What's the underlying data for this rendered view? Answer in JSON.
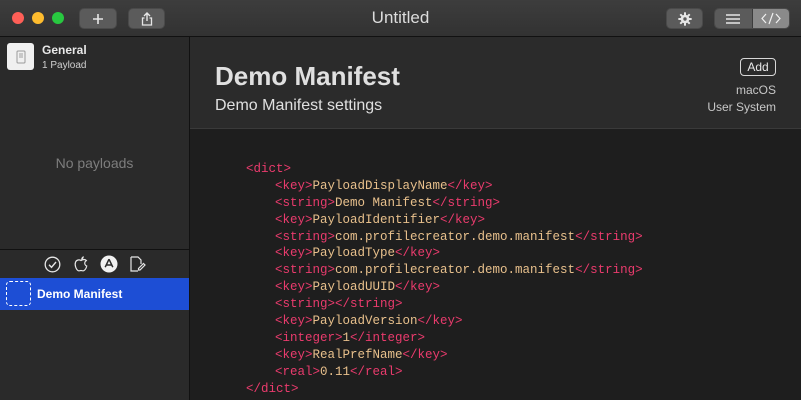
{
  "window": {
    "title": "Untitled",
    "toolbar": {
      "add_icon": "plus-icon",
      "share_icon": "share-icon",
      "gear_icon": "gear-icon",
      "view_list_icon": "list-icon",
      "view_code_icon": "code-icon"
    }
  },
  "sidebar": {
    "general": {
      "name": "General",
      "subtitle": "1 Payload",
      "icon": "document-icon"
    },
    "empty_text": "No payloads",
    "filters": [
      {
        "icon": "checkmark-circle-icon"
      },
      {
        "icon": "apple-icon"
      },
      {
        "icon": "app-store-icon"
      },
      {
        "icon": "edit-document-icon"
      }
    ],
    "manifests": [
      {
        "label": "Demo Manifest",
        "selected": true
      }
    ]
  },
  "header": {
    "title": "Demo Manifest",
    "subtitle": "Demo Manifest settings",
    "add_label": "Add",
    "platform": "macOS",
    "scope": "User System"
  },
  "code": {
    "open_dict": "<dict>",
    "close_dict": "</dict>",
    "entries": [
      {
        "tag": "key",
        "value": "PayloadDisplayName"
      },
      {
        "tag": "string",
        "value": "Demo Manifest"
      },
      {
        "tag": "key",
        "value": "PayloadIdentifier"
      },
      {
        "tag": "string",
        "value": "com.profilecreator.demo.manifest"
      },
      {
        "tag": "key",
        "value": "PayloadType"
      },
      {
        "tag": "string",
        "value": "com.profilecreator.demo.manifest"
      },
      {
        "tag": "key",
        "value": "PayloadUUID"
      },
      {
        "tag": "string",
        "value": ""
      },
      {
        "tag": "key",
        "value": "PayloadVersion"
      },
      {
        "tag": "integer",
        "value": "1"
      },
      {
        "tag": "key",
        "value": "RealPrefName"
      },
      {
        "tag": "real",
        "value": "0.11"
      }
    ]
  },
  "colors": {
    "accent": "#1d4ed5",
    "xml_tag": "#ea3b6d",
    "xml_text": "#e8c08c"
  }
}
